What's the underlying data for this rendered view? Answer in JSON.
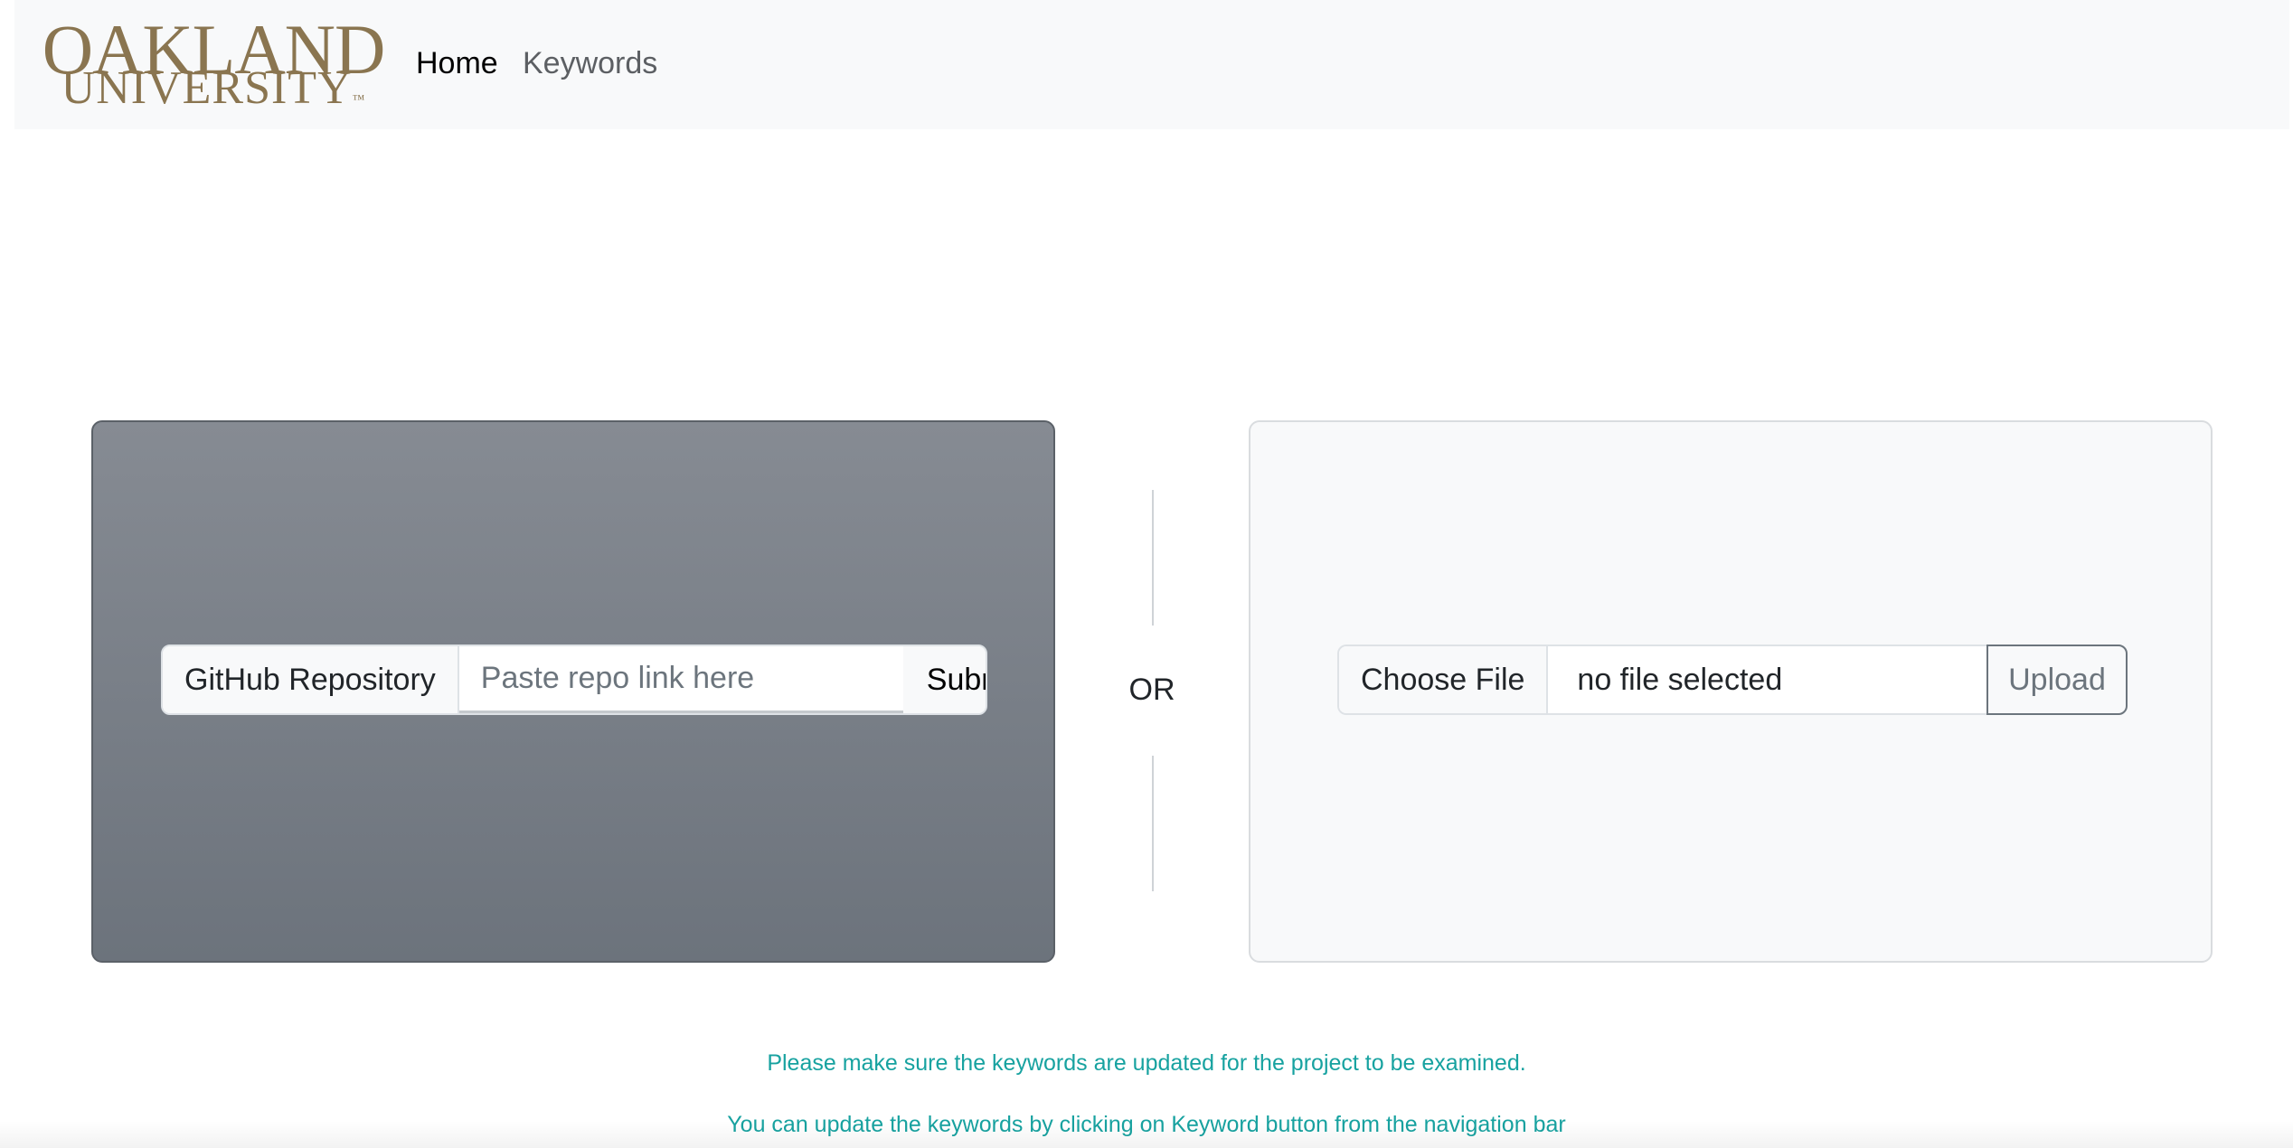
{
  "navbar": {
    "logo": {
      "line1": "OAKLAND",
      "line2": "UNIVERSITY",
      "trademark": "™"
    },
    "links": [
      {
        "label": "Home",
        "active": true
      },
      {
        "label": "Keywords",
        "active": false
      }
    ]
  },
  "github_card": {
    "label": "GitHub Repository",
    "input_value": "",
    "input_placeholder": "Paste repo link here",
    "submit_label": "Submit"
  },
  "separator": {
    "label": "OR"
  },
  "upload_card": {
    "choose_file_label": "Choose File",
    "file_status": "no file selected",
    "upload_label": "Upload"
  },
  "notes": [
    "Please make sure the keywords are updated for the project to be examined.",
    "You can update the keywords by clicking on Keyword button from the navigation bar"
  ],
  "colors": {
    "brand_gold": "#8a7550",
    "note_teal": "#17a2a0",
    "navbar_bg": "#f8f9fa",
    "github_card_gradient": [
      "#868b93",
      "#6c737c"
    ]
  }
}
